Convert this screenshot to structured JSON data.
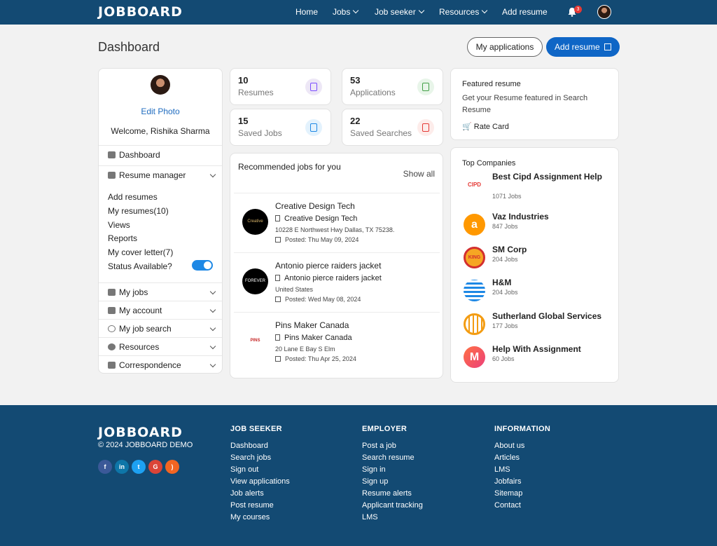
{
  "header": {
    "logo": "JOBBOARD",
    "nav": [
      "Home",
      "Jobs",
      "Job seeker",
      "Resources",
      "Add resume"
    ],
    "notification_count": "3"
  },
  "page": {
    "title": "Dashboard",
    "my_applications": "My applications",
    "add_resume": "Add resume"
  },
  "profile": {
    "edit_photo": "Edit Photo",
    "welcome": "Welcome, Rishika Sharma"
  },
  "sidebar": {
    "dashboard": "Dashboard",
    "resume_manager": "Resume manager",
    "sub": [
      "Add resumes",
      "My resumes(10)",
      "Views",
      "Reports",
      "My cover letter(7)",
      "Status Available?"
    ],
    "status_available": true,
    "menu": [
      "My jobs",
      "My account",
      "My job search",
      "Resources",
      "Correspondence"
    ]
  },
  "stats": [
    {
      "num": "10",
      "label": "Resumes",
      "icon": "resume-icon",
      "color": "#7c4dff",
      "bg": "#ede7f6"
    },
    {
      "num": "53",
      "label": "Applications",
      "icon": "briefcase-icon",
      "color": "#43a047",
      "bg": "#e8f5e9"
    },
    {
      "num": "15",
      "label": "Saved Jobs",
      "icon": "bookmark-icon",
      "color": "#1e88e5",
      "bg": "#e3f2fd"
    },
    {
      "num": "22",
      "label": "Saved Searches",
      "icon": "download-icon",
      "color": "#e53935",
      "bg": "#fdecea"
    }
  ],
  "recommended": {
    "title": "Recommended jobs for you",
    "show_all": "Show all",
    "jobs": [
      {
        "title": "Creative Design Tech",
        "company": "Creative Design Tech",
        "address": "10228 E Northwest Hwy Dallas, TX 75238.",
        "posted": "Posted: Thu May 09, 2024"
      },
      {
        "title": "Antonio pierce raiders jacket",
        "company": "Antonio pierce raiders jacket",
        "address": "United States",
        "posted": "Posted: Wed May 08, 2024"
      },
      {
        "title": "Pins Maker Canada",
        "company": "Pins Maker Canada",
        "address": "20 Lane E Bay S Elm",
        "posted": "Posted: Thu Apr 25, 2024"
      }
    ]
  },
  "featured": {
    "title": "Featured resume",
    "desc": "Get your Resume featured in Search Resume",
    "rate": "Rate Card"
  },
  "companies": {
    "title": "Top Companies",
    "items": [
      {
        "name": "Best Cipd Assignment Help",
        "jobs": "1071 Jobs",
        "color": "#e53935"
      },
      {
        "name": "Vaz Industries",
        "jobs": "847 Jobs",
        "color": "#ff9800"
      },
      {
        "name": "SM Corp",
        "jobs": "204 Jobs",
        "color": "#d32f2f"
      },
      {
        "name": "H&M",
        "jobs": "204 Jobs",
        "color": "#1e88e5"
      },
      {
        "name": "Sutherland Global Services",
        "jobs": "177 Jobs",
        "color": "#f39c12"
      },
      {
        "name": "Help With Assignment",
        "jobs": "60 Jobs",
        "color": "#ec407a"
      }
    ]
  },
  "footer": {
    "logo": "JOBBOARD",
    "copyright": "© 2024 JOBBOARD DEMO",
    "cols": [
      {
        "title": "JOB SEEKER",
        "links": [
          "Dashboard",
          "Search jobs",
          "Sign out",
          "View applications",
          "Job alerts",
          "Post resume",
          "My courses"
        ]
      },
      {
        "title": "EMPLOYER",
        "links": [
          "Post a job",
          "Search resume",
          "Sign in",
          "Sign up",
          "Resume alerts",
          "Applicant tracking",
          "LMS"
        ]
      },
      {
        "title": "INFORMATION",
        "links": [
          "About us",
          "Articles",
          "LMS",
          "Jobfairs",
          "Sitemap",
          "Contact"
        ]
      }
    ],
    "social": [
      {
        "icon": "facebook-icon",
        "color": "#3b5998"
      },
      {
        "icon": "linkedin-icon",
        "color": "#0e76a8"
      },
      {
        "icon": "twitter-icon",
        "color": "#1da1f2"
      },
      {
        "icon": "google-icon",
        "color": "#db4437"
      },
      {
        "icon": "rss-icon",
        "color": "#f26522"
      }
    ]
  }
}
